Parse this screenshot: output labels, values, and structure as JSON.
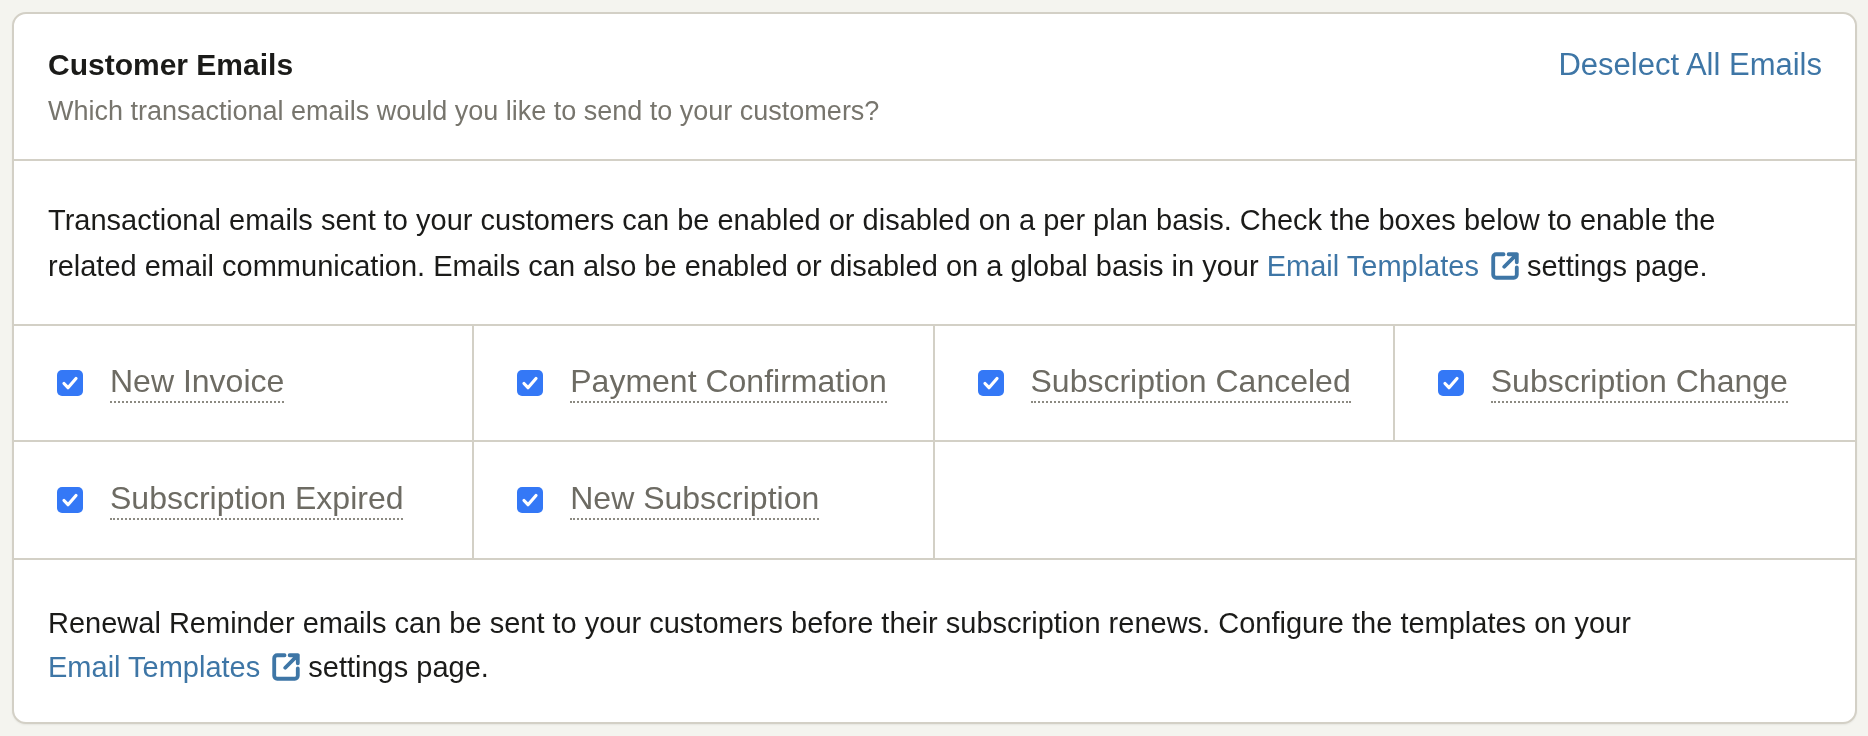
{
  "header": {
    "title": "Customer Emails",
    "subtitle": "Which transactional emails would you like to send to your customers?",
    "action": "Deselect All Emails"
  },
  "intro": {
    "text_before": "Transactional emails sent to your customers can be enabled or disabled on a per plan basis. Check the boxes below to enable the related email communication. Emails can also be enabled or disabled on a global basis in your",
    "link": "Email Templates",
    "text_after": "settings page."
  },
  "emails": [
    {
      "label": "New Invoice",
      "checked": true
    },
    {
      "label": "Payment Confirmation",
      "checked": true
    },
    {
      "label": "Subscription Canceled",
      "checked": true
    },
    {
      "label": "Subscription Change",
      "checked": true
    },
    {
      "label": "Subscription Expired",
      "checked": true
    },
    {
      "label": "New Subscription",
      "checked": true
    }
  ],
  "renewal": {
    "text_before": "Renewal Reminder emails can be sent to your customers before their subscription renews. Configure the templates on your",
    "link": "Email Templates",
    "text_after": "settings page."
  }
}
